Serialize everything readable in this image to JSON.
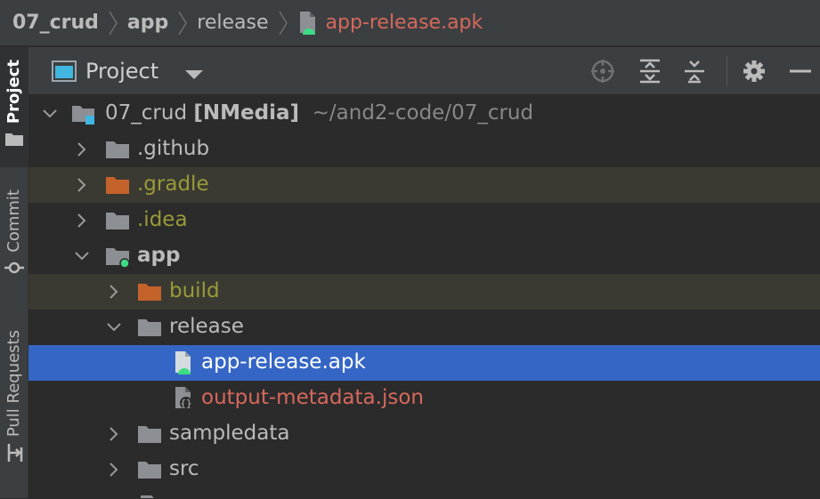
{
  "breadcrumb": {
    "items": [
      "07_crud",
      "app",
      "release"
    ],
    "file": "app-release.apk"
  },
  "toolstrip": {
    "project": "Project",
    "commit": "Commit",
    "pull_requests": "Pull Requests"
  },
  "header": {
    "title": "Project"
  },
  "tree": {
    "root_name": "07_crud",
    "root_module": "[NMedia]",
    "root_path": "~/and2-code/07_crud",
    "github": ".github",
    "gradle": ".gradle",
    "idea": ".idea",
    "app": "app",
    "build": "build",
    "release": "release",
    "apk": "app-release.apk",
    "metadata": "output-metadata.json",
    "sampledata": "sampledata",
    "src": "src"
  },
  "colors": {
    "selection": "#3566c5",
    "ignored_bg": "#3b3a32",
    "ignored_text": "#999a3a",
    "modified_text": "#d6685c",
    "excluded_folder": "#c4622c"
  }
}
